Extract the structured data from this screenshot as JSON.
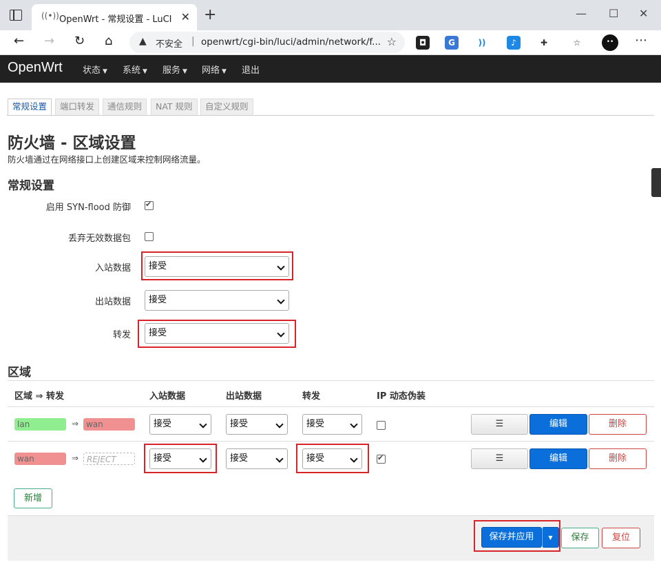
{
  "browser": {
    "tab_title": "OpenWrt - 常规设置 - LuCI",
    "insecure_label": "不安全",
    "url": "openwrt/cgi-bin/luci/admin/network/f..."
  },
  "header": {
    "brand": "OpenWrt",
    "menu": [
      "状态",
      "系统",
      "服务",
      "网络",
      "退出"
    ]
  },
  "tabs": [
    "常规设置",
    "端口转发",
    "通信规则",
    "NAT 规则",
    "自定义规则"
  ],
  "page": {
    "title": "防火墙 - 区域设置",
    "description": "防火墙通过在网络接口上创建区域来控制网络流量。"
  },
  "general": {
    "section_title": "常规设置",
    "syn_flood_label": "启用 SYN-flood 防御",
    "syn_flood_checked": true,
    "drop_invalid_label": "丢弃无效数据包",
    "drop_invalid_checked": false,
    "input_label": "入站数据",
    "input_value": "接受",
    "output_label": "出站数据",
    "output_value": "接受",
    "forward_label": "转发",
    "forward_value": "接受"
  },
  "zones": {
    "section_title": "区域",
    "headers": [
      "区域 ⇒ 转发",
      "入站数据",
      "出站数据",
      "转发",
      "IP 动态伪装"
    ],
    "rows": [
      {
        "zone": "lan",
        "zone_color": "#90ee90",
        "dest": "wan",
        "dest_color": "#f09090",
        "input": "接受",
        "output": "接受",
        "forward": "接受",
        "masq": false
      },
      {
        "zone": "wan",
        "zone_color": "#f09090",
        "dest": "REJECT",
        "dest_color": "",
        "input": "接受",
        "output": "接受",
        "forward": "接受",
        "masq": true
      }
    ],
    "drag_label": "☰",
    "edit_label": "编辑",
    "delete_label": "删除",
    "add_label": "新增"
  },
  "footer": {
    "save_apply_label": "保存并应用",
    "save_label": "保存",
    "reset_label": "复位"
  }
}
